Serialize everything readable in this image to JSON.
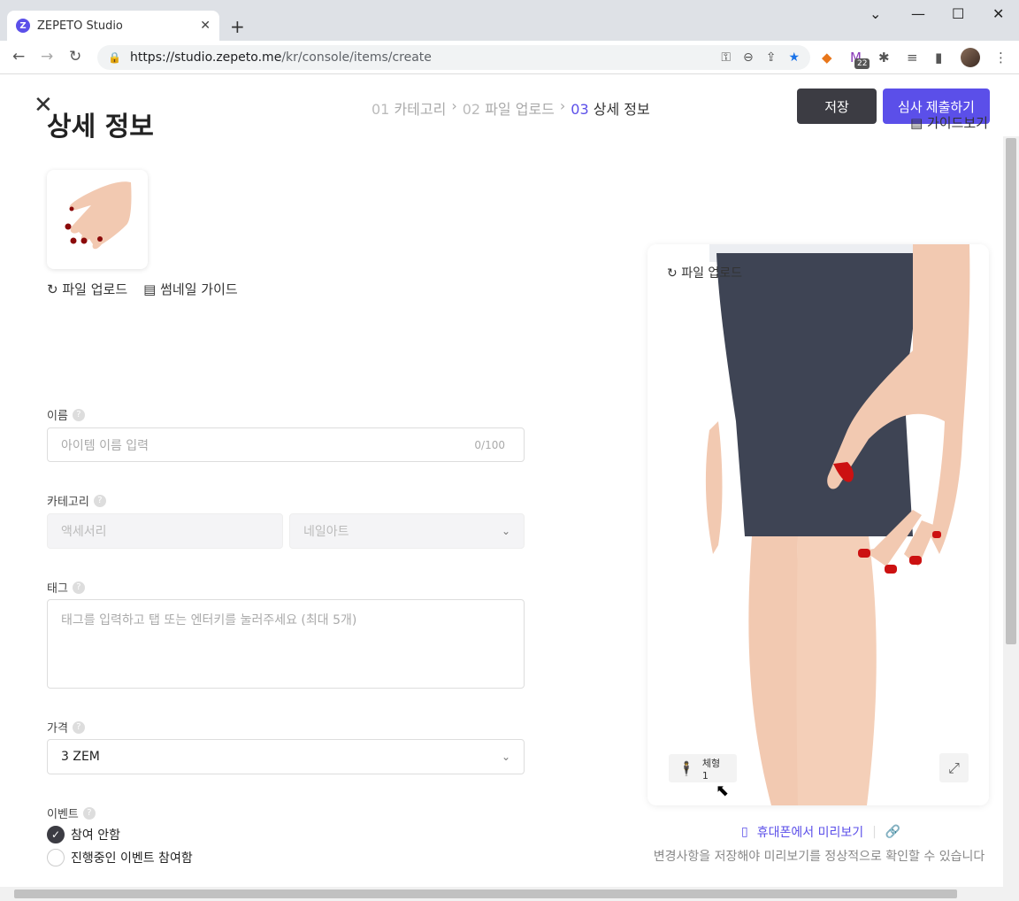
{
  "browser": {
    "tab_title": "ZEPETO Studio",
    "tab_icon_letter": "Z",
    "url_host": "https://studio.zepeto.me",
    "url_path": "/kr/console/items/create",
    "ext_badge": "22"
  },
  "header": {
    "steps": [
      {
        "num": "01",
        "label": "카테고리"
      },
      {
        "num": "02",
        "label": "파일 업로드"
      },
      {
        "num": "03",
        "label": "상세 정보"
      }
    ],
    "save_label": "저장",
    "submit_label": "심사 제출하기"
  },
  "main": {
    "title": "상세 정보",
    "guide_label": "가이드보기",
    "upload_label": "파일 업로드",
    "thumb_guide_label": "썸네일 가이드",
    "name": {
      "label": "이름",
      "placeholder": "아이템 이름 입력",
      "counter": "0/100"
    },
    "category": {
      "label": "카테고리",
      "primary": "액세서리",
      "secondary": "네일아트"
    },
    "tag": {
      "label": "태그",
      "placeholder": "태그를 입력하고 탭 또는 엔터키를 눌러주세요 (최대 5개)"
    },
    "price": {
      "label": "가격",
      "value": "3 ZEM"
    },
    "event": {
      "label": "이벤트",
      "options": [
        "참여 안함",
        "진행중인 이벤트 참여함"
      ],
      "selected": 0
    }
  },
  "preview": {
    "upload_label": "파일 업로드",
    "body_type": "체형 1",
    "mobile_label": "휴대폰에서 미리보기",
    "notice": "변경사항을 저장해야 미리보기를 정상적으로 확인할 수 있습니다"
  },
  "colors": {
    "accent": "#5b4fe9",
    "dark": "#3c3c43"
  }
}
